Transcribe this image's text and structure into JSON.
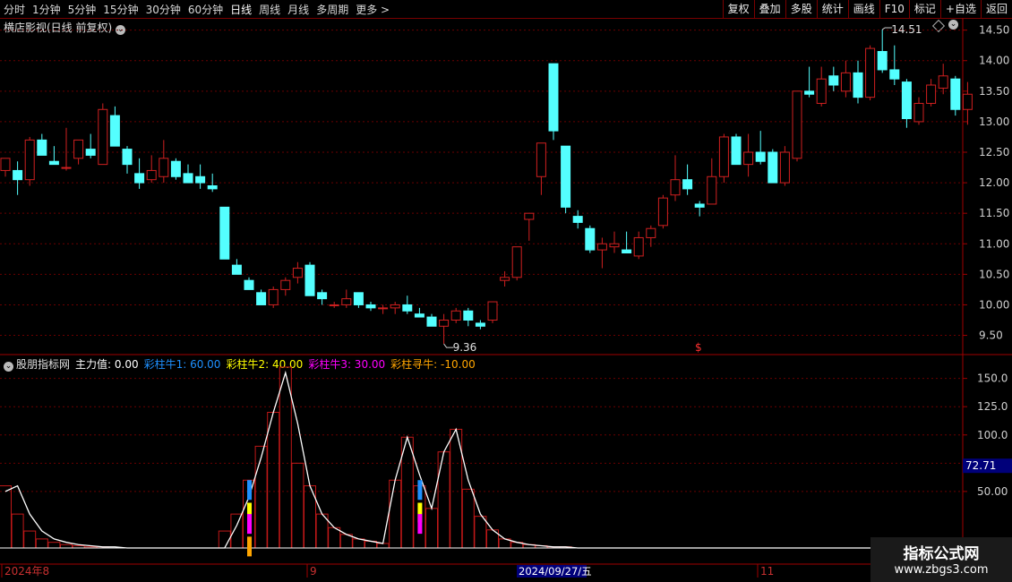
{
  "toolbar": {
    "periods": [
      "分时",
      "1分钟",
      "5分钟",
      "15分钟",
      "30分钟",
      "60分钟",
      "日线",
      "周线",
      "月线",
      "多周期",
      "更多 >"
    ],
    "active_period": "日线",
    "tools": [
      "复权",
      "叠加",
      "多股",
      "统计",
      "画线",
      "F10",
      "标记",
      "+自选",
      "返回"
    ]
  },
  "main_chart": {
    "title": "横店影视(日线 前复权)",
    "y_ticks": [
      "14.50",
      "14.00",
      "13.50",
      "13.00",
      "12.50",
      "12.00",
      "11.50",
      "11.00",
      "10.50",
      "10.00",
      "9.50"
    ],
    "high_label": "14.51",
    "low_label": "9.36",
    "marker": "$"
  },
  "indicator": {
    "name": "股朋指标网",
    "items": [
      {
        "label": "主力值: 0.00",
        "color": "#ffffff"
      },
      {
        "label": "彩柱牛1: 60.00",
        "color": "#1e90ff"
      },
      {
        "label": "彩柱牛2: 40.00",
        "color": "#ffff00"
      },
      {
        "label": "彩柱牛3: 30.00",
        "color": "#ff00ff"
      },
      {
        "label": "彩柱寻牛: -10.00",
        "color": "#ffa500"
      }
    ],
    "y_ticks": [
      "150.0",
      "125.0",
      "100.0",
      "75.00",
      "50.00"
    ],
    "current_value": "72.71"
  },
  "date_axis": {
    "labels": [
      "2024年8",
      "9",
      "11"
    ],
    "cursor": "2024/09/27/五"
  },
  "watermark": {
    "line1": "指标公式网",
    "line2": "www.zbgs3.com"
  },
  "chart_data": {
    "type": "candlestick",
    "ylim": [
      9.2,
      14.7
    ],
    "candles": [
      [
        12.2,
        12.4,
        12.1,
        12.4
      ],
      [
        12.2,
        12.35,
        11.8,
        12.05
      ],
      [
        12.05,
        12.75,
        11.95,
        12.7
      ],
      [
        12.7,
        12.8,
        12.45,
        12.45
      ],
      [
        12.35,
        12.6,
        12.3,
        12.3
      ],
      [
        12.25,
        12.9,
        12.2,
        12.25
      ],
      [
        12.4,
        12.7,
        12.3,
        12.7
      ],
      [
        12.55,
        12.8,
        12.4,
        12.45
      ],
      [
        12.3,
        13.3,
        12.3,
        13.2
      ],
      [
        13.1,
        13.25,
        12.6,
        12.6
      ],
      [
        12.55,
        12.6,
        12.15,
        12.3
      ],
      [
        12.15,
        12.4,
        11.9,
        12.0
      ],
      [
        12.05,
        12.45,
        12.0,
        12.2
      ],
      [
        12.1,
        12.7,
        12.0,
        12.4
      ],
      [
        12.35,
        12.4,
        12.05,
        12.1
      ],
      [
        12.15,
        12.3,
        12.0,
        12.0
      ],
      [
        12.1,
        12.3,
        11.9,
        12.0
      ],
      [
        11.95,
        12.15,
        11.85,
        11.9
      ],
      [
        11.6,
        11.6,
        10.75,
        10.75
      ],
      [
        10.65,
        10.75,
        10.5,
        10.5
      ],
      [
        10.4,
        10.45,
        10.25,
        10.25
      ],
      [
        10.2,
        10.25,
        10.0,
        10.0
      ],
      [
        10.0,
        10.3,
        9.95,
        10.25
      ],
      [
        10.25,
        10.45,
        10.15,
        10.4
      ],
      [
        10.45,
        10.7,
        10.35,
        10.6
      ],
      [
        10.65,
        10.7,
        10.15,
        10.15
      ],
      [
        10.2,
        10.25,
        10.0,
        10.1
      ],
      [
        10.0,
        10.05,
        9.95,
        10.0
      ],
      [
        10.0,
        10.25,
        9.95,
        10.1
      ],
      [
        10.2,
        10.2,
        9.95,
        10.0
      ],
      [
        10.0,
        10.05,
        9.9,
        9.95
      ],
      [
        9.95,
        10.0,
        9.85,
        9.95
      ],
      [
        9.95,
        10.05,
        9.85,
        10.0
      ],
      [
        10.0,
        10.15,
        9.85,
        9.9
      ],
      [
        9.85,
        9.95,
        9.8,
        9.8
      ],
      [
        9.8,
        9.85,
        9.65,
        9.65
      ],
      [
        9.65,
        9.85,
        9.36,
        9.75
      ],
      [
        9.75,
        9.95,
        9.7,
        9.9
      ],
      [
        9.9,
        9.95,
        9.65,
        9.75
      ],
      [
        9.7,
        9.75,
        9.6,
        9.65
      ],
      [
        9.75,
        10.05,
        9.7,
        10.05
      ],
      [
        10.4,
        10.55,
        10.3,
        10.45
      ],
      [
        10.45,
        10.95,
        10.4,
        10.95
      ],
      [
        11.4,
        11.5,
        11.05,
        11.5
      ],
      [
        12.1,
        12.65,
        11.8,
        12.65
      ],
      [
        13.95,
        13.95,
        12.7,
        12.85
      ],
      [
        12.6,
        12.6,
        11.5,
        11.6
      ],
      [
        11.45,
        11.55,
        11.25,
        11.35
      ],
      [
        11.25,
        11.3,
        10.85,
        10.9
      ],
      [
        10.9,
        11.1,
        10.6,
        11.0
      ],
      [
        10.95,
        11.2,
        10.85,
        11.0
      ],
      [
        10.9,
        11.2,
        10.85,
        10.85
      ],
      [
        10.8,
        11.2,
        10.75,
        11.1
      ],
      [
        11.1,
        11.3,
        10.95,
        11.25
      ],
      [
        11.3,
        11.8,
        11.25,
        11.75
      ],
      [
        11.8,
        12.45,
        11.7,
        12.05
      ],
      [
        12.05,
        12.3,
        11.8,
        11.9
      ],
      [
        11.65,
        11.7,
        11.45,
        11.6
      ],
      [
        11.65,
        12.4,
        11.65,
        12.1
      ],
      [
        12.1,
        12.8,
        12.0,
        12.75
      ],
      [
        12.75,
        12.8,
        12.3,
        12.3
      ],
      [
        12.3,
        12.8,
        12.1,
        12.5
      ],
      [
        12.5,
        12.85,
        12.3,
        12.35
      ],
      [
        12.5,
        12.55,
        12.15,
        12.0
      ],
      [
        12.0,
        12.6,
        11.95,
        12.5
      ],
      [
        12.4,
        13.5,
        12.35,
        13.5
      ],
      [
        13.5,
        13.9,
        13.4,
        13.45
      ],
      [
        13.3,
        13.9,
        13.25,
        13.7
      ],
      [
        13.75,
        13.9,
        13.5,
        13.6
      ],
      [
        13.5,
        14.0,
        13.4,
        13.8
      ],
      [
        13.8,
        14.0,
        13.3,
        13.4
      ],
      [
        13.4,
        14.25,
        13.35,
        14.2
      ],
      [
        14.15,
        14.51,
        13.8,
        13.85
      ],
      [
        13.85,
        14.25,
        13.6,
        13.7
      ],
      [
        13.65,
        13.7,
        12.9,
        13.05
      ],
      [
        13.0,
        13.4,
        12.95,
        13.3
      ],
      [
        13.3,
        13.7,
        13.25,
        13.6
      ],
      [
        13.55,
        13.95,
        13.45,
        13.75
      ],
      [
        13.7,
        13.75,
        13.1,
        13.2
      ],
      [
        13.2,
        13.65,
        12.95,
        13.45
      ]
    ],
    "indicator_bars": [
      55,
      30,
      15,
      8,
      5,
      3,
      2,
      1,
      1,
      0,
      0,
      0,
      0,
      0,
      0,
      0,
      0,
      0,
      15,
      30,
      60,
      90,
      120,
      160,
      75,
      55,
      30,
      18,
      12,
      8,
      6,
      4,
      60,
      98,
      55,
      35,
      85,
      105,
      52,
      28,
      16,
      8,
      5,
      3,
      2,
      1,
      1,
      0,
      0,
      0,
      0,
      0,
      0,
      0,
      0,
      0,
      0,
      0,
      0,
      0,
      0,
      0,
      0,
      0,
      0,
      0,
      0,
      0,
      0,
      0,
      0,
      0,
      0,
      0,
      0,
      0,
      0,
      0,
      0,
      0
    ],
    "indicator_line": [
      50,
      55,
      30,
      15,
      8,
      5,
      3,
      2,
      1,
      1,
      0,
      0,
      0,
      0,
      0,
      0,
      0,
      0,
      0,
      20,
      45,
      80,
      120,
      155,
      110,
      55,
      30,
      18,
      12,
      8,
      6,
      4,
      60,
      98,
      65,
      35,
      85,
      105,
      60,
      30,
      16,
      8,
      5,
      3,
      2,
      1,
      1,
      0,
      0,
      0,
      0,
      0,
      0,
      0,
      0,
      0,
      0,
      0,
      0,
      0,
      0,
      0,
      0,
      0,
      0,
      0,
      0,
      0,
      0,
      0,
      0,
      0,
      0,
      0,
      0,
      0,
      0,
      0,
      0,
      0
    ],
    "indicator_ylim": [
      0,
      160
    ],
    "colored_columns": [
      {
        "index": 20,
        "levels": [
          60,
          40,
          30,
          -10
        ]
      },
      {
        "index": 34,
        "levels": [
          60,
          40,
          30
        ]
      }
    ]
  }
}
